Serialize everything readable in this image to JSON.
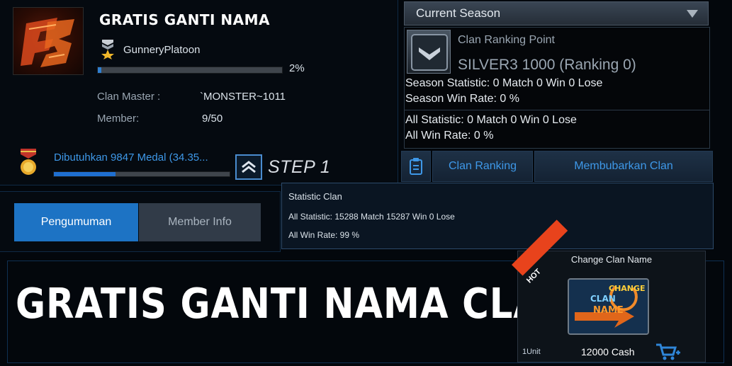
{
  "clan": {
    "title": "GRATIS GANTI NAMA",
    "rank_name": "GunneryPlatoon",
    "exp_percent_label": "2%",
    "exp_fraction": 0.02,
    "master_label": "Clan Master :",
    "master_value": "`MONSTER~1011",
    "member_label": "Member:",
    "member_value": "9/50",
    "medal_text": "Dibutuhkan 9847 Medal (34.35...",
    "medal_fraction": 0.35,
    "step_label": "STEP 1"
  },
  "season": {
    "dropdown_label": "Current Season",
    "ranking_point_label": "Clan Ranking Point",
    "ranking_point_value": "SILVER3 1000 (Ranking 0)",
    "season_statistic": "Season Statistic: 0 Match 0 Win 0 Lose",
    "season_win_rate": "Season Win Rate: 0 %",
    "all_statistic": "All Statistic: 0 Match 0 Win 0 Lose",
    "all_win_rate": "All Win Rate: 0 %"
  },
  "actions": {
    "clan_ranking": "Clan Ranking",
    "dissolve_clan": "Membubarkan Clan"
  },
  "tooltip": {
    "title": "Statistic Clan",
    "all_statistic": "All Statistic: 15288 Match 15287 Win 0 Lose",
    "all_win_rate": "All Win Rate: 99 %"
  },
  "tabs": {
    "announcement": "Pengumuman",
    "member_info": "Member Info"
  },
  "banner": {
    "text": "GRATIS GANTI NAMA CLAN"
  },
  "shop": {
    "title": "Change Clan Name",
    "hot_label": "HOT",
    "item_line1": "CHANGE",
    "item_line2": "CLAN",
    "item_line3": "NAME",
    "unit": "1Unit",
    "price": "12000 Cash"
  },
  "icons": {
    "clan_logo": "clan-emblem-icon",
    "rank": "rank-insignia-icon",
    "medal": "medal-icon",
    "step": "chevron-up-icon",
    "season_badge": "rank-badge-icon",
    "clipboard": "clipboard-icon",
    "cart": "add-to-cart-icon"
  },
  "colors": {
    "accent_blue": "#1d73c4",
    "link_blue": "#3e98e8",
    "hot_red": "#e8431c"
  }
}
